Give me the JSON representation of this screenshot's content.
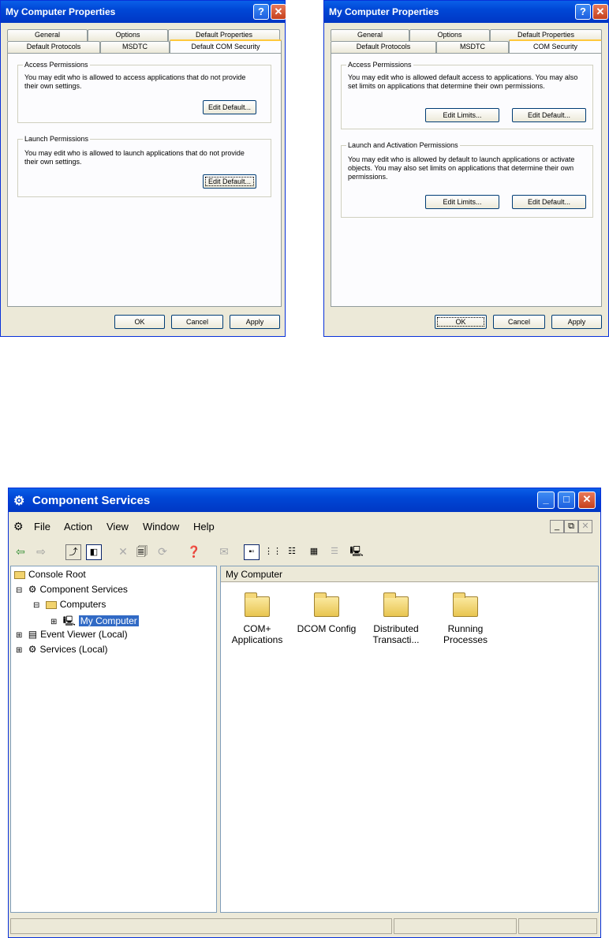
{
  "dialog_left": {
    "title": "My Computer Properties",
    "help": "?",
    "close": "✕",
    "tabs_row1": [
      "General",
      "Options",
      "Default Properties"
    ],
    "tabs_row2": [
      "Default Protocols",
      "MSDTC",
      "Default COM Security"
    ],
    "groups": [
      {
        "label": "Access Permissions",
        "text": "You may edit who is allowed to access applications that do not provide their own settings.",
        "buttons": [
          "Edit Default..."
        ]
      },
      {
        "label": "Launch Permissions",
        "text": "You may edit who is allowed to launch applications that do not provide their own settings.",
        "buttons": [
          "Edit Default..."
        ]
      }
    ],
    "footer": [
      "OK",
      "Cancel",
      "Apply"
    ]
  },
  "dialog_right": {
    "title": "My Computer Properties",
    "help": "?",
    "close": "✕",
    "tabs_row1": [
      "General",
      "Options",
      "Default Properties"
    ],
    "tabs_row2": [
      "Default Protocols",
      "MSDTC",
      "COM Security"
    ],
    "groups": [
      {
        "label": "Access Permissions",
        "text": "You may edit who is allowed default access to applications. You may also set limits on applications that determine their own permissions.",
        "buttons": [
          "Edit Limits...",
          "Edit Default..."
        ]
      },
      {
        "label": "Launch and Activation Permissions",
        "text": "You may edit who is allowed by default to launch applications or activate objects. You may also set limits on applications that determine their own permissions.",
        "buttons": [
          "Edit Limits...",
          "Edit Default..."
        ]
      }
    ],
    "footer": [
      "OK",
      "Cancel",
      "Apply"
    ]
  },
  "mmc": {
    "title": "Component Services",
    "menus": [
      "File",
      "Action",
      "View",
      "Window",
      "Help"
    ],
    "tree": {
      "root": "Console Root",
      "component_services": "Component Services",
      "computers": "Computers",
      "my_computer": "My Computer",
      "event_viewer": "Event Viewer (Local)",
      "services": "Services (Local)"
    },
    "right_header": "My Computer",
    "items": [
      {
        "label": "COM+ Applications"
      },
      {
        "label": "DCOM Config"
      },
      {
        "label": "Distributed Transacti..."
      },
      {
        "label": "Running Processes"
      }
    ]
  }
}
